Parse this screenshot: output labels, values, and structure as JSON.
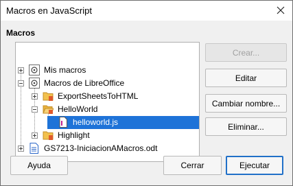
{
  "window": {
    "title": "Macros en JavaScript"
  },
  "section": {
    "label": "Macros"
  },
  "tree": {
    "items": [
      {
        "label": "Mis macros",
        "icon": "macro-library-icon",
        "expander": "collapsed"
      },
      {
        "label": "Macros de LibreOffice",
        "icon": "macro-library-icon",
        "expander": "expanded"
      },
      {
        "label": "ExportSheetsToHTML",
        "icon": "folder-icon",
        "expander": "collapsed"
      },
      {
        "label": "HelloWorld",
        "icon": "open-folder-icon",
        "expander": "expanded"
      },
      {
        "label": "helloworld.js",
        "icon": "script-file-icon",
        "selected": true
      },
      {
        "label": "Highlight",
        "icon": "folder-icon",
        "expander": "collapsed"
      },
      {
        "label": "GS7213-IniciacionAMacros.odt",
        "icon": "writer-document-icon",
        "expander": "collapsed"
      }
    ]
  },
  "buttons": {
    "create": {
      "label": "Crear...",
      "enabled": false
    },
    "edit": {
      "label": "Editar"
    },
    "rename": {
      "label": "Cambiar nombre..."
    },
    "delete": {
      "label": "Eliminar..."
    },
    "help": {
      "label": "Ayuda"
    },
    "close": {
      "label": "Cerrar"
    },
    "run": {
      "label": "Ejecutar"
    }
  },
  "colors": {
    "selection": "#1e73d8",
    "default_button_border": "#2070c8",
    "folder": "#f2c14e"
  }
}
